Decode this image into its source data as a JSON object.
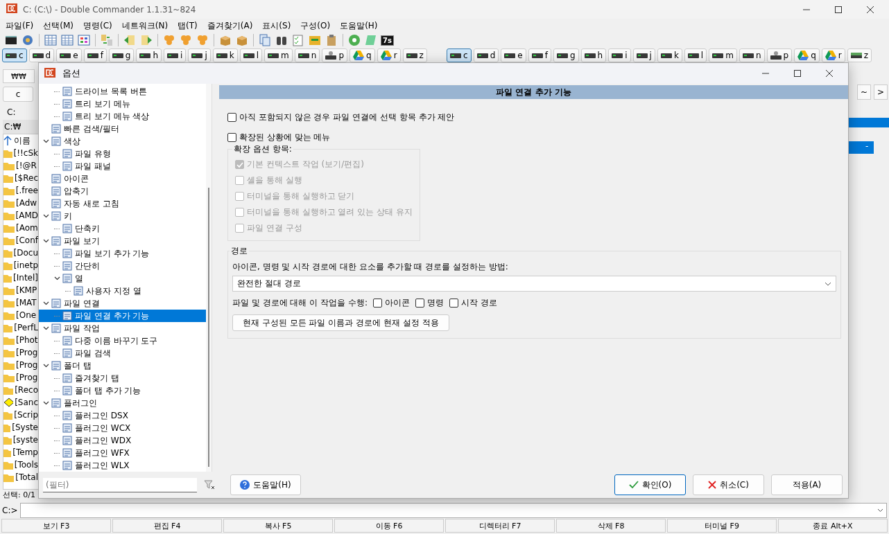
{
  "window": {
    "title": "C: (C:\\) - Double Commander 1.1.31~824"
  },
  "menu": [
    "파일(F)",
    "선택(M)",
    "명령(C)",
    "네트워크(N)",
    "탭(T)",
    "즐겨찾기(A)",
    "표시(S)",
    "구성(O)",
    "도움말(H)"
  ],
  "toolbar": {
    "badge": "7s"
  },
  "drives_left": [
    {
      "letter": "c",
      "kind": "disk",
      "selected": true
    },
    {
      "letter": "d",
      "kind": "disk",
      "selected": false
    },
    {
      "letter": "e",
      "kind": "disk",
      "selected": false
    },
    {
      "letter": "f",
      "kind": "disk",
      "selected": false
    },
    {
      "letter": "g",
      "kind": "disk",
      "selected": false
    },
    {
      "letter": "h",
      "kind": "disk",
      "selected": false
    },
    {
      "letter": "i",
      "kind": "disk",
      "selected": false
    },
    {
      "letter": "j",
      "kind": "disk",
      "selected": false
    },
    {
      "letter": "k",
      "kind": "disk",
      "selected": false
    },
    {
      "letter": "l",
      "kind": "disk",
      "selected": false
    },
    {
      "letter": "m",
      "kind": "disk",
      "selected": false
    },
    {
      "letter": "n",
      "kind": "disk",
      "selected": false
    },
    {
      "letter": "p",
      "kind": "network",
      "selected": false
    },
    {
      "letter": "q",
      "kind": "cloud",
      "selected": false
    },
    {
      "letter": "r",
      "kind": "cloud",
      "selected": false
    },
    {
      "letter": "z",
      "kind": "disk",
      "selected": false
    }
  ],
  "drives_right": [
    {
      "letter": "c",
      "kind": "disk",
      "selected": true
    },
    {
      "letter": "d",
      "kind": "disk",
      "selected": false
    },
    {
      "letter": "e",
      "kind": "disk",
      "selected": false
    },
    {
      "letter": "f",
      "kind": "disk",
      "selected": false
    },
    {
      "letter": "g",
      "kind": "disk",
      "selected": false
    },
    {
      "letter": "h",
      "kind": "disk",
      "selected": false
    },
    {
      "letter": "i",
      "kind": "disk",
      "selected": false
    },
    {
      "letter": "j",
      "kind": "disk",
      "selected": false
    },
    {
      "letter": "k",
      "kind": "disk",
      "selected": false
    },
    {
      "letter": "l",
      "kind": "disk",
      "selected": false
    },
    {
      "letter": "m",
      "kind": "disk",
      "selected": false
    },
    {
      "letter": "n",
      "kind": "disk",
      "selected": false
    },
    {
      "letter": "p",
      "kind": "network",
      "selected": false
    },
    {
      "letter": "q",
      "kind": "cloud",
      "selected": false
    },
    {
      "letter": "r",
      "kind": "cloud",
      "selected": false
    },
    {
      "letter": "z",
      "kind": "usb",
      "selected": false
    }
  ],
  "left_panel": {
    "network_button": "₩₩",
    "drive_tab": "c",
    "drive_label": "C:",
    "path": "C:₩",
    "column": "이름",
    "files": [
      {
        "name": "[!!cSk",
        "kind": "folder"
      },
      {
        "name": "[!@R",
        "kind": "folder"
      },
      {
        "name": "[$Rec",
        "kind": "folder"
      },
      {
        "name": "[.free",
        "kind": "folder"
      },
      {
        "name": "[Adw",
        "kind": "folder"
      },
      {
        "name": "[AMD",
        "kind": "folder"
      },
      {
        "name": "[Aom",
        "kind": "folder"
      },
      {
        "name": "[Conf",
        "kind": "folder"
      },
      {
        "name": "[Docu",
        "kind": "folder"
      },
      {
        "name": "[inetp",
        "kind": "folder"
      },
      {
        "name": "[Intel]",
        "kind": "folder"
      },
      {
        "name": "[KMP",
        "kind": "folder"
      },
      {
        "name": "[MAT",
        "kind": "folder"
      },
      {
        "name": "[One",
        "kind": "folder"
      },
      {
        "name": "[PerfL",
        "kind": "folder"
      },
      {
        "name": "[Phot",
        "kind": "folder"
      },
      {
        "name": "[Prog",
        "kind": "folder"
      },
      {
        "name": "[Prog",
        "kind": "folder"
      },
      {
        "name": "[Prog",
        "kind": "folder"
      },
      {
        "name": "[Reco",
        "kind": "folder"
      },
      {
        "name": "[Sanc",
        "kind": "sandbox"
      },
      {
        "name": "[Scrip",
        "kind": "folder"
      },
      {
        "name": "[Syste",
        "kind": "folder"
      },
      {
        "name": "[syste",
        "kind": "folder"
      },
      {
        "name": "[Temp",
        "kind": "folder"
      },
      {
        "name": "[Tools",
        "kind": "folder"
      },
      {
        "name": "[Total",
        "kind": "folder"
      }
    ],
    "status": "선택: 0/1"
  },
  "right_panel": {
    "buttons": [
      "~",
      ">"
    ],
    "selected_row": "-"
  },
  "command_line": {
    "prompt": "C:>"
  },
  "function_keys": [
    "보기 F3",
    "편집 F4",
    "복사 F5",
    "이동 F6",
    "디렉터리 F7",
    "삭제 F8",
    "터미널 F9",
    "종료 Alt+X"
  ],
  "dialog": {
    "title": "옵션",
    "tree": {
      "partial_children": [
        {
          "label": "드라이브 목록 버튼",
          "selected": false
        },
        {
          "label": "트리 보기 메뉴",
          "selected": false
        },
        {
          "label": "트리 보기 메뉴 색상",
          "selected": false
        }
      ],
      "items": [
        {
          "label": "빠른 검색/필터",
          "selected": false
        },
        {
          "label": "색상",
          "selected": false,
          "expanded": true,
          "children": [
            {
              "label": "파일 유형",
              "selected": false
            },
            {
              "label": "파일 패널",
              "selected": false
            }
          ]
        },
        {
          "label": "아이콘",
          "selected": false
        },
        {
          "label": "압축기",
          "selected": false
        },
        {
          "label": "자동 새로 고침",
          "selected": false
        },
        {
          "label": "키",
          "selected": false,
          "expanded": true,
          "children": [
            {
              "label": "단축키",
              "selected": false
            }
          ]
        },
        {
          "label": "파일 보기",
          "selected": false,
          "expanded": true,
          "children": [
            {
              "label": "파일 보기 추가 기능",
              "selected": false
            },
            {
              "label": "간단히",
              "selected": false
            },
            {
              "label": "열",
              "selected": false,
              "expanded": true,
              "children": [
                {
                  "label": "사용자 지정 열",
                  "selected": false
                }
              ]
            }
          ]
        },
        {
          "label": "파일 연결",
          "selected": false,
          "expanded": true,
          "children": [
            {
              "label": "파일 연결 추가 기능",
              "selected": true
            }
          ]
        },
        {
          "label": "파일 작업",
          "selected": false,
          "expanded": true,
          "children": [
            {
              "label": "다중 이름 바꾸기 도구",
              "selected": false
            },
            {
              "label": "파일 검색",
              "selected": false
            }
          ]
        },
        {
          "label": "폴더 탭",
          "selected": false,
          "expanded": true,
          "children": [
            {
              "label": "즐겨찾기 탭",
              "selected": false
            },
            {
              "label": "폴더 탭 추가 기능",
              "selected": false
            }
          ]
        },
        {
          "label": "플러그인",
          "selected": false,
          "expanded": true,
          "children": [
            {
              "label": "플러그인 DSX",
              "selected": false
            },
            {
              "label": "플러그인 WCX",
              "selected": false
            },
            {
              "label": "플러그인 WDX",
              "selected": false
            },
            {
              "label": "플러그인 WFX",
              "selected": false
            },
            {
              "label": "플러그인 WLX",
              "selected": false
            }
          ]
        }
      ]
    },
    "filter": {
      "placeholder": "(필터)"
    },
    "header": "파일 연결 추가 기능",
    "options": [
      {
        "label": "아직 포함되지 않은 경우 파일 연결에 선택 항목 추가 제안",
        "checked": false
      },
      {
        "label": "확장된 상황에 맞는 메뉴",
        "checked": false
      }
    ],
    "extended_group": {
      "title": "확장 옵션 항목:",
      "options": [
        {
          "label": "기본 컨텍스트 작업 (보기/편집)",
          "checked": true,
          "disabled": true
        },
        {
          "label": "셸을 통해 실행",
          "checked": false,
          "disabled": true
        },
        {
          "label": "터미널을 통해 실행하고 닫기",
          "checked": false,
          "disabled": true
        },
        {
          "label": "터미널을 통해 실행하고 열려 있는 상태 유지",
          "checked": false,
          "disabled": true
        },
        {
          "label": "파일 연결 구성",
          "checked": false,
          "disabled": true
        }
      ]
    },
    "path_group": {
      "title": "경로",
      "description": "아이콘, 명령 및 시작 경로에 대한 요소를 추가할 때 경로를 설정하는 방법:",
      "mode": "완전한 절대 경로",
      "apply_label": "파일 및 경로에 대해 이 작업을 수행:",
      "targets": [
        {
          "label": "아이콘",
          "checked": false
        },
        {
          "label": "명령",
          "checked": false
        },
        {
          "label": "시작 경로",
          "checked": false
        }
      ],
      "apply_button": "현재 구성된 모든 파일 이름과 경로에 현재 설정 적용"
    },
    "buttons": {
      "help": "도움말(H)",
      "ok": "확인(O)",
      "cancel": "취소(C)",
      "apply": "적용(A)"
    }
  }
}
